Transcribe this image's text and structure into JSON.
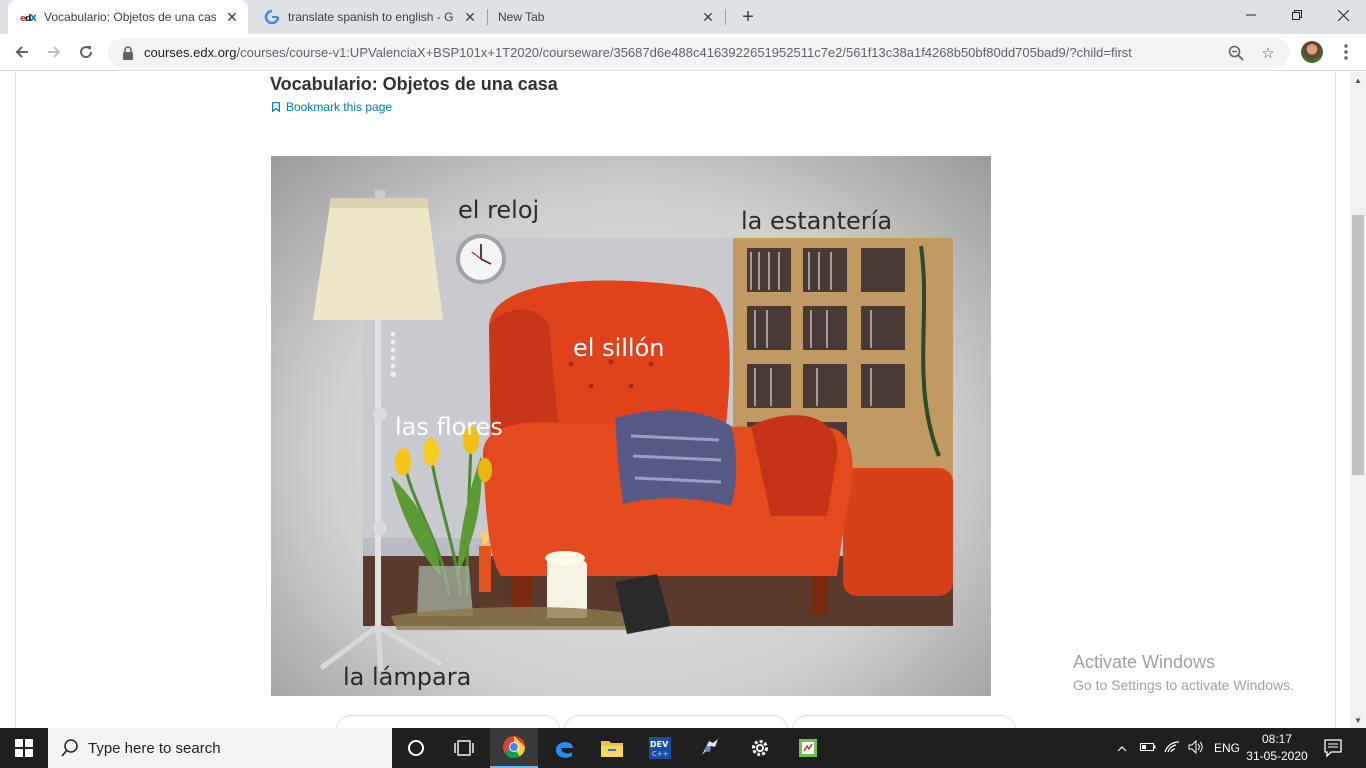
{
  "browser": {
    "tabs": [
      {
        "title": "Vocabulario: Objetos de una casa",
        "favicon": "edx-icon",
        "active": true
      },
      {
        "title": "translate spanish to english - Google Search",
        "favicon": "google-icon",
        "active": false
      },
      {
        "title": "New Tab",
        "favicon": "",
        "active": false
      }
    ],
    "url_host": "courses.edx.org",
    "url_path": "/courses/course-v1:UPValenciaX+BSP101x+1T2020/courseware/35687d6e488c4163922651952511c7e2/561f13c38a1f4268b50bf80dd705bad9/?child=first"
  },
  "page": {
    "title": "Vocabulario: Objetos de una casa",
    "bookmark_label": "Bookmark this page",
    "image_labels": {
      "reloj": "el reloj",
      "estanteria": "la estantería",
      "sillon": "el sillón",
      "flores": "las flores",
      "lampara": "la lámpara"
    }
  },
  "watermark": {
    "line1": "Activate Windows",
    "line2": "Go to Settings to activate Windows."
  },
  "taskbar": {
    "search_placeholder": "Type here to search",
    "language": "ENG",
    "time": "08:17",
    "date": "31-05-2020",
    "apps": [
      "task-view-icon",
      "chrome-icon",
      "edge-icon",
      "file-explorer-icon",
      "devcpp-icon",
      "app-icon",
      "settings-icon",
      "notepad-icon"
    ]
  },
  "colors": {
    "accent_link": "#0075b4",
    "chair": "#e0431b",
    "taskbar": "#1f1f1f"
  }
}
